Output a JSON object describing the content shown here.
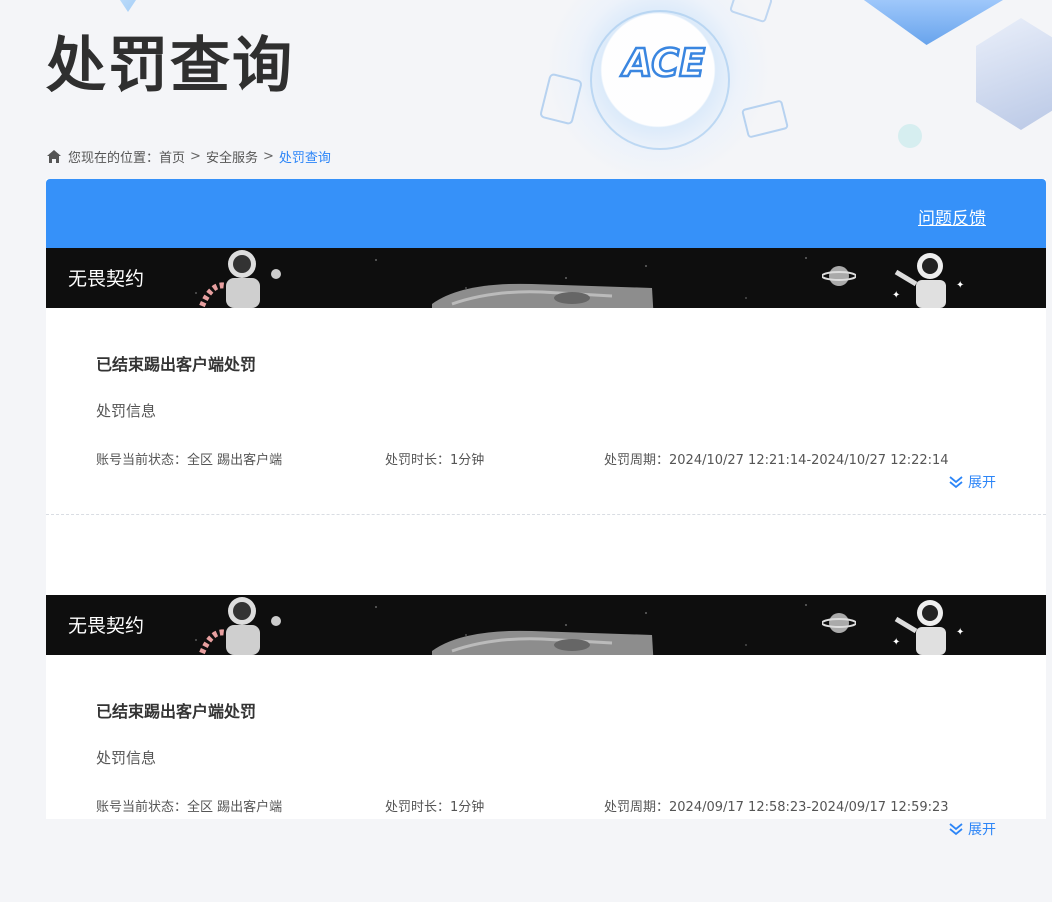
{
  "page": {
    "title": "处罚查询"
  },
  "breadcrumb": {
    "prefix": "您现在的位置：",
    "items": [
      "首页",
      "安全服务",
      "处罚查询"
    ],
    "separator": ">"
  },
  "header": {
    "logo_text": "ACE"
  },
  "panel": {
    "feedback_label": "问题反馈",
    "accent_color": "#3691f9"
  },
  "records": [
    {
      "game": "无畏契约",
      "title": "已结束踢出客户端处罚",
      "subtitle": "处罚信息",
      "status": "账号当前状态：全区 踢出客户端",
      "duration": "处罚时长：1分钟",
      "period": "处罚周期：2024/10/27 12:21:14-2024/10/27 12:22:14",
      "expand_label": "展开"
    },
    {
      "game": "无畏契约",
      "title": "已结束踢出客户端处罚",
      "subtitle": "处罚信息",
      "status": "账号当前状态：全区 踢出客户端",
      "duration": "处罚时长：1分钟",
      "period": "处罚周期：2024/09/17 12:58:23-2024/09/17 12:59:23",
      "expand_label": "展开"
    }
  ]
}
